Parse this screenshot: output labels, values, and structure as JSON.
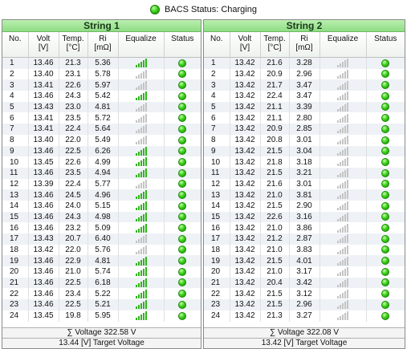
{
  "status": {
    "text": "BACS Status: Charging",
    "color": "#2fcf1a"
  },
  "columns": {
    "no": "No.",
    "volt": "Volt",
    "volt_unit": "[V]",
    "temp": "Temp.",
    "temp_unit": "[°C]",
    "ri": "Ri",
    "ri_unit": "[mΩ]",
    "equalize": "Equalize",
    "status": "Status"
  },
  "strings": [
    {
      "title": "String 1",
      "sum_voltage": "∑ Voltage 322.58 V",
      "target_voltage": "13.44 [V] Target Voltage",
      "rows": [
        {
          "no": "1",
          "volt": "13.46",
          "temp": "21.3",
          "ri": "5.36",
          "eq": 5
        },
        {
          "no": "2",
          "volt": "13.40",
          "temp": "23.1",
          "ri": "5.78",
          "eq": 0
        },
        {
          "no": "3",
          "volt": "13.41",
          "temp": "22.6",
          "ri": "5.97",
          "eq": 0
        },
        {
          "no": "4",
          "volt": "13.46",
          "temp": "24.3",
          "ri": "5.42",
          "eq": 5
        },
        {
          "no": "5",
          "volt": "13.43",
          "temp": "23.0",
          "ri": "4.81",
          "eq": 0
        },
        {
          "no": "6",
          "volt": "13.41",
          "temp": "23.5",
          "ri": "5.72",
          "eq": 0
        },
        {
          "no": "7",
          "volt": "13.41",
          "temp": "22.4",
          "ri": "5.64",
          "eq": 0
        },
        {
          "no": "8",
          "volt": "13.40",
          "temp": "22.0",
          "ri": "5.49",
          "eq": 0
        },
        {
          "no": "9",
          "volt": "13.46",
          "temp": "22.5",
          "ri": "6.26",
          "eq": 5
        },
        {
          "no": "10",
          "volt": "13.45",
          "temp": "22.6",
          "ri": "4.99",
          "eq": 5
        },
        {
          "no": "11",
          "volt": "13.46",
          "temp": "23.5",
          "ri": "4.94",
          "eq": 5
        },
        {
          "no": "12",
          "volt": "13.39",
          "temp": "22.4",
          "ri": "5.77",
          "eq": 0
        },
        {
          "no": "13",
          "volt": "13.46",
          "temp": "24.5",
          "ri": "4.96",
          "eq": 5
        },
        {
          "no": "14",
          "volt": "13.46",
          "temp": "24.0",
          "ri": "5.15",
          "eq": 5
        },
        {
          "no": "15",
          "volt": "13.46",
          "temp": "24.3",
          "ri": "4.98",
          "eq": 5
        },
        {
          "no": "16",
          "volt": "13.46",
          "temp": "23.2",
          "ri": "5.09",
          "eq": 5
        },
        {
          "no": "17",
          "volt": "13.43",
          "temp": "20.7",
          "ri": "6.40",
          "eq": 0
        },
        {
          "no": "18",
          "volt": "13.42",
          "temp": "22.0",
          "ri": "5.76",
          "eq": 0
        },
        {
          "no": "19",
          "volt": "13.46",
          "temp": "22.9",
          "ri": "4.81",
          "eq": 5
        },
        {
          "no": "20",
          "volt": "13.46",
          "temp": "21.0",
          "ri": "5.74",
          "eq": 5
        },
        {
          "no": "21",
          "volt": "13.46",
          "temp": "22.5",
          "ri": "6.18",
          "eq": 5
        },
        {
          "no": "22",
          "volt": "13.46",
          "temp": "23.4",
          "ri": "5.22",
          "eq": 5
        },
        {
          "no": "23",
          "volt": "13.46",
          "temp": "22.5",
          "ri": "5.21",
          "eq": 5
        },
        {
          "no": "24",
          "volt": "13.45",
          "temp": "19.8",
          "ri": "5.95",
          "eq": 5
        }
      ]
    },
    {
      "title": "String 2",
      "sum_voltage": "∑ Voltage 322.08 V",
      "target_voltage": "13.42 [V] Target Voltage",
      "rows": [
        {
          "no": "1",
          "volt": "13.42",
          "temp": "21.6",
          "ri": "3.28",
          "eq": 0
        },
        {
          "no": "2",
          "volt": "13.42",
          "temp": "20.9",
          "ri": "2.96",
          "eq": 0
        },
        {
          "no": "3",
          "volt": "13.42",
          "temp": "21.7",
          "ri": "3.47",
          "eq": 0
        },
        {
          "no": "4",
          "volt": "13.42",
          "temp": "22.4",
          "ri": "3.47",
          "eq": 0
        },
        {
          "no": "5",
          "volt": "13.42",
          "temp": "21.1",
          "ri": "3.39",
          "eq": 0
        },
        {
          "no": "6",
          "volt": "13.42",
          "temp": "21.1",
          "ri": "2.80",
          "eq": 0
        },
        {
          "no": "7",
          "volt": "13.42",
          "temp": "20.9",
          "ri": "2.85",
          "eq": 0
        },
        {
          "no": "8",
          "volt": "13.42",
          "temp": "20.8",
          "ri": "3.01",
          "eq": 0
        },
        {
          "no": "9",
          "volt": "13.42",
          "temp": "21.5",
          "ri": "3.04",
          "eq": 0
        },
        {
          "no": "10",
          "volt": "13.42",
          "temp": "21.8",
          "ri": "3.18",
          "eq": 0
        },
        {
          "no": "11",
          "volt": "13.42",
          "temp": "21.5",
          "ri": "3.21",
          "eq": 0
        },
        {
          "no": "12",
          "volt": "13.42",
          "temp": "21.6",
          "ri": "3.01",
          "eq": 0
        },
        {
          "no": "13",
          "volt": "13.42",
          "temp": "21.0",
          "ri": "3.81",
          "eq": 0
        },
        {
          "no": "14",
          "volt": "13.42",
          "temp": "21.5",
          "ri": "2.90",
          "eq": 0
        },
        {
          "no": "15",
          "volt": "13.42",
          "temp": "22.6",
          "ri": "3.16",
          "eq": 0
        },
        {
          "no": "16",
          "volt": "13.42",
          "temp": "21.0",
          "ri": "3.86",
          "eq": 0
        },
        {
          "no": "17",
          "volt": "13.42",
          "temp": "21.2",
          "ri": "2.87",
          "eq": 0
        },
        {
          "no": "18",
          "volt": "13.42",
          "temp": "21.0",
          "ri": "3.83",
          "eq": 0
        },
        {
          "no": "19",
          "volt": "13.42",
          "temp": "21.5",
          "ri": "4.01",
          "eq": 0
        },
        {
          "no": "20",
          "volt": "13.42",
          "temp": "21.0",
          "ri": "3.17",
          "eq": 0
        },
        {
          "no": "21",
          "volt": "13.42",
          "temp": "20.4",
          "ri": "3.42",
          "eq": 0
        },
        {
          "no": "22",
          "volt": "13.42",
          "temp": "21.5",
          "ri": "3.12",
          "eq": 0
        },
        {
          "no": "23",
          "volt": "13.42",
          "temp": "21.5",
          "ri": "2.96",
          "eq": 0
        },
        {
          "no": "24",
          "volt": "13.42",
          "temp": "21.3",
          "ri": "3.27",
          "eq": 0
        }
      ]
    }
  ]
}
